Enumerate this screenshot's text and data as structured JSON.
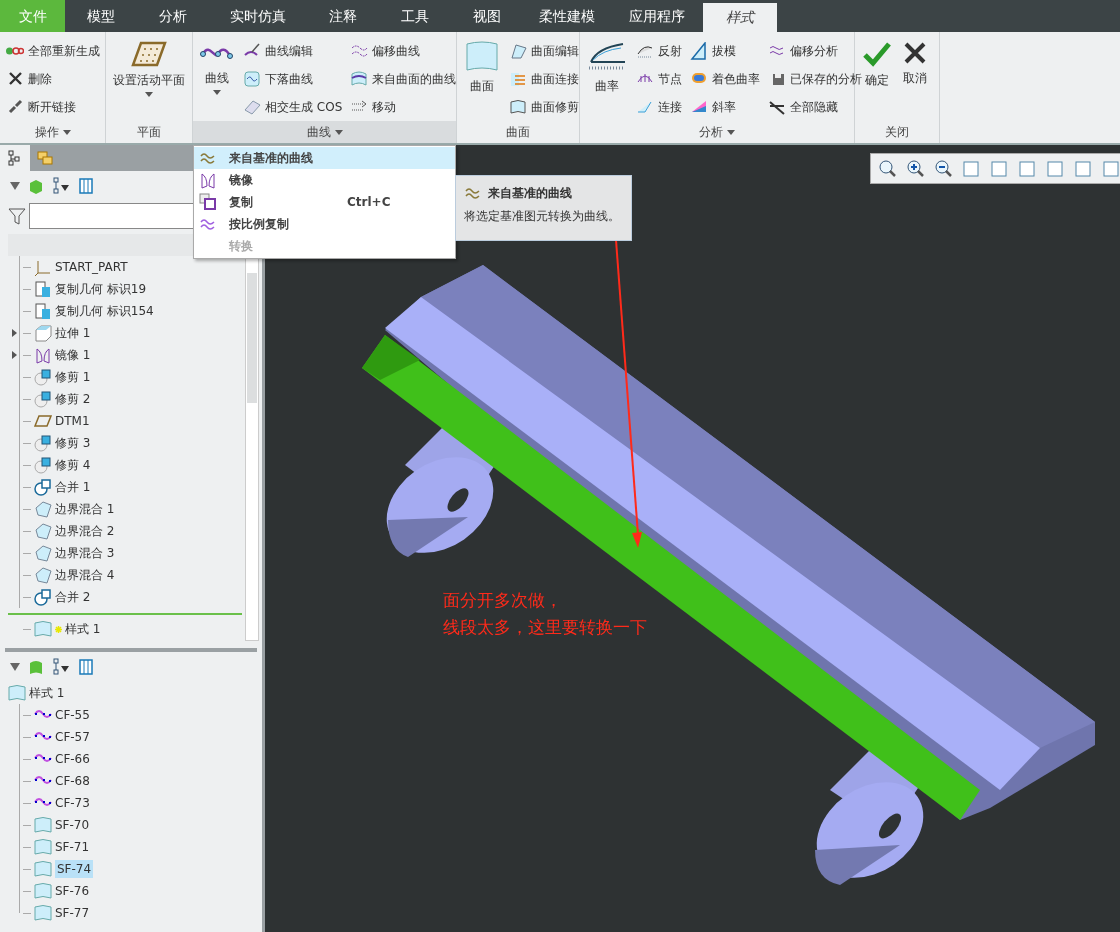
{
  "tabs": [
    {
      "label": "文件",
      "kind": "file",
      "selected": false
    },
    {
      "label": "模型",
      "kind": "normal",
      "selected": false
    },
    {
      "label": "分析",
      "kind": "normal",
      "selected": false
    },
    {
      "label": "实时仿真",
      "kind": "normal",
      "selected": false
    },
    {
      "label": "注释",
      "kind": "normal",
      "selected": false
    },
    {
      "label": "工具",
      "kind": "normal",
      "selected": false
    },
    {
      "label": "视图",
      "kind": "normal",
      "selected": false
    },
    {
      "label": "柔性建模",
      "kind": "normal",
      "selected": false
    },
    {
      "label": "应用程序",
      "kind": "normal",
      "selected": false
    },
    {
      "label": "样式",
      "kind": "normal",
      "selected": true
    }
  ],
  "ribbon": {
    "groups": [
      {
        "label": "操作",
        "menu": true,
        "expanded": false,
        "columns": [
          [
            "全部重新生成",
            "删除",
            "断开链接"
          ]
        ]
      },
      {
        "label": "平面",
        "menu": false,
        "expanded": false,
        "large": [
          {
            "label": "设置活动平面",
            "dropdown": true
          }
        ]
      },
      {
        "label": "曲线",
        "menu": true,
        "expanded": true,
        "large": [
          {
            "label": "曲线",
            "dropdown": true
          }
        ],
        "columns": [
          [
            "曲线编辑",
            "下落曲线",
            "相交生成 COS"
          ],
          [
            "偏移曲线",
            "来自曲面的曲线",
            "移动"
          ]
        ]
      },
      {
        "label": "曲面",
        "menu": false,
        "expanded": false,
        "large": [
          {
            "label": "曲面",
            "dropdown": false
          }
        ],
        "columns": [
          [
            "曲面编辑",
            "曲面连接",
            "曲面修剪"
          ]
        ]
      },
      {
        "label": "分析",
        "menu": true,
        "expanded": false,
        "large": [
          {
            "label": "曲率",
            "dropdown": false
          }
        ],
        "columns": [
          [
            "反射",
            "节点",
            "连接"
          ],
          [
            "拔模",
            "着色曲率",
            "斜率"
          ],
          [
            "偏移分析",
            "已保存的分析",
            "全部隐藏"
          ]
        ]
      },
      {
        "label": "关闭",
        "menu": false,
        "expanded": false,
        "large": [
          {
            "label": "确定",
            "dropdown": false
          },
          {
            "label": "取消",
            "dropdown": false
          }
        ]
      }
    ]
  },
  "menu": {
    "items": [
      {
        "label": "来自基准的曲线",
        "selected": true,
        "disabled": false
      },
      {
        "label": "镜像",
        "selected": false,
        "disabled": false
      },
      {
        "label": "复制",
        "shortcut": "Ctrl+C",
        "selected": false,
        "disabled": false
      },
      {
        "label": "按比例复制",
        "selected": false,
        "disabled": false
      },
      {
        "label": "转换",
        "selected": false,
        "disabled": true
      }
    ]
  },
  "tooltip": {
    "title": "来自基准的曲线",
    "text": "将选定基准图元转换为曲线。"
  },
  "panel_tabs": [
    {
      "selected": true
    },
    {
      "selected": false
    }
  ],
  "model_tree": {
    "items": [
      {
        "label": "START_PART",
        "kind": "csys",
        "collapsed": false
      },
      {
        "label": "复制几何 标识19",
        "kind": "copy",
        "collapsed": false
      },
      {
        "label": "复制几何 标识154",
        "kind": "copy",
        "collapsed": false
      },
      {
        "label": "拉伸 1",
        "kind": "extrude",
        "collapsed": true
      },
      {
        "label": "镜像 1",
        "kind": "mirror",
        "collapsed": true
      },
      {
        "label": "修剪 1",
        "kind": "trim",
        "collapsed": false
      },
      {
        "label": "修剪 2",
        "kind": "trim",
        "collapsed": false
      },
      {
        "label": "DTM1",
        "kind": "plane",
        "collapsed": false
      },
      {
        "label": "修剪 3",
        "kind": "trim",
        "collapsed": false
      },
      {
        "label": "修剪 4",
        "kind": "trim",
        "collapsed": false
      },
      {
        "label": "合并 1",
        "kind": "merge",
        "collapsed": false
      },
      {
        "label": "边界混合 1",
        "kind": "blend",
        "collapsed": false
      },
      {
        "label": "边界混合 2",
        "kind": "blend",
        "collapsed": false
      },
      {
        "label": "边界混合 3",
        "kind": "blend",
        "collapsed": false
      },
      {
        "label": "边界混合 4",
        "kind": "blend",
        "collapsed": false
      },
      {
        "label": "合并 2",
        "kind": "merge",
        "collapsed": false
      }
    ],
    "after_insert": [
      {
        "label": "样式 1",
        "kind": "style",
        "collapsed": false
      }
    ]
  },
  "style_tree": {
    "label": "样式 1",
    "children": [
      {
        "label": "CF-55",
        "kind": "curve",
        "selected": false
      },
      {
        "label": "CF-57",
        "kind": "curve",
        "selected": false
      },
      {
        "label": "CF-66",
        "kind": "curve",
        "selected": false
      },
      {
        "label": "CF-68",
        "kind": "curve",
        "selected": false
      },
      {
        "label": "CF-73",
        "kind": "curve",
        "selected": false
      },
      {
        "label": "SF-70",
        "kind": "surface",
        "selected": false
      },
      {
        "label": "SF-71",
        "kind": "surface",
        "selected": false
      },
      {
        "label": "SF-74",
        "kind": "surface",
        "selected": true
      },
      {
        "label": "SF-76",
        "kind": "surface",
        "selected": false
      },
      {
        "label": "SF-77",
        "kind": "surface",
        "selected": false
      }
    ]
  },
  "annotation": {
    "lines": [
      "面分开多次做，",
      "线段太多，这里要转换一下"
    ]
  }
}
